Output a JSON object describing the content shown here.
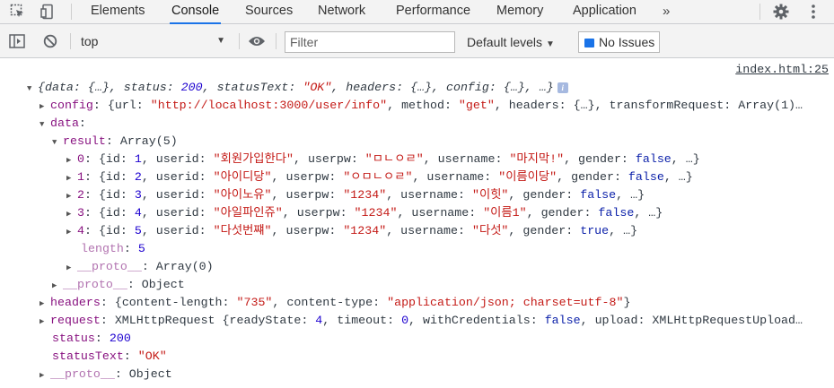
{
  "tabs": [
    "Elements",
    "Console",
    "Sources",
    "Network",
    "Performance",
    "Memory",
    "Application"
  ],
  "tabs_overflow": "»",
  "active_tab": "Console",
  "toolbar": {
    "context": "top",
    "filter_placeholder": "Filter",
    "levels": "Default levels",
    "issues": "No Issues"
  },
  "console": {
    "source_link": "index.html:25",
    "summary": {
      "k1": "data",
      "v1": "{…}",
      "k2": "status",
      "v2": "200",
      "k3": "statusText",
      "v3": "\"OK\"",
      "k4": "headers",
      "v4": "{…}",
      "k5": "config",
      "v5": "{…}",
      "tail": "…"
    },
    "config": {
      "key": "config",
      "url_key": "url",
      "url_val": "\"http://localhost:3000/user/info\"",
      "method_key": "method",
      "method_val": "\"get\"",
      "headers_key": "headers",
      "headers_val": "{…}",
      "tr_key": "transformRequest",
      "tr_val": "Array(1)…"
    },
    "data_key": "data",
    "result": {
      "key": "result",
      "type": "Array(5)"
    },
    "users": [
      {
        "index": "0",
        "id": "1",
        "userid": "\"회원가입한다\"",
        "userpw": "\"ㅁㄴㅇㄹ\"",
        "username": "\"마지막!\"",
        "gender": "false"
      },
      {
        "index": "1",
        "id": "2",
        "userid": "\"아이디당\"",
        "userpw": "\"ㅇㅁㄴㅇㄹ\"",
        "username": "\"이름이당\"",
        "gender": "false"
      },
      {
        "index": "2",
        "id": "3",
        "userid": "\"아이노유\"",
        "userpw": "\"1234\"",
        "username": "\"이힛\"",
        "gender": "false"
      },
      {
        "index": "3",
        "id": "4",
        "userid": "\"아일파인쥬\"",
        "userpw": "\"1234\"",
        "username": "\"이름1\"",
        "gender": "false"
      },
      {
        "index": "4",
        "id": "5",
        "userid": "\"다섯번쨰\"",
        "userpw": "\"1234\"",
        "username": "\"다섯\"",
        "gender": "true"
      }
    ],
    "length_key": "length",
    "length_val": "5",
    "proto_key": "__proto__",
    "proto_array": "Array(0)",
    "proto_object": "Object",
    "resp_headers": {
      "key": "headers",
      "cl_key": "content-length",
      "cl_val": "\"735\"",
      "ct_key": "content-type",
      "ct_val": "\"application/json; charset=utf-8\""
    },
    "request": {
      "key": "request",
      "type": "XMLHttpRequest",
      "rs_key": "readyState",
      "rs_val": "4",
      "to_key": "timeout",
      "to_val": "0",
      "wc_key": "withCredentials",
      "wc_val": "false",
      "up_key": "upload",
      "up_val": "XMLHttpRequestUpload…"
    },
    "status": {
      "key": "status",
      "val": "200"
    },
    "status_text": {
      "key": "statusText",
      "val": "\"OK\""
    }
  },
  "colors": {
    "accent": "#1a73e8",
    "key": "#881280",
    "string": "#c41a16",
    "number": "#1c00cf"
  }
}
